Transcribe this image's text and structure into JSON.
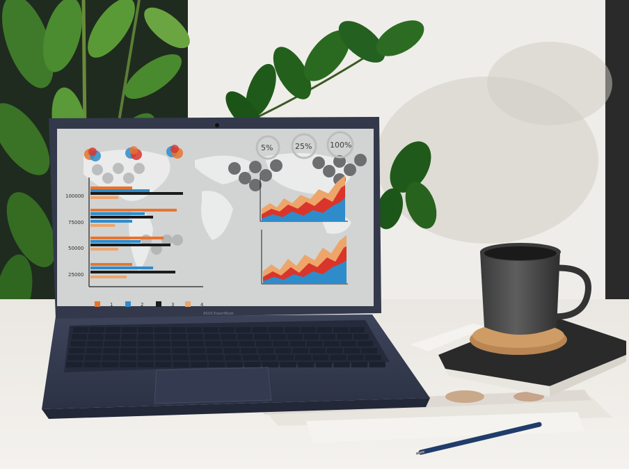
{
  "laptop": {
    "brand": "ASUS ExpertBook"
  },
  "screen": {
    "percentages": [
      "5%",
      "25%",
      "100%"
    ],
    "y_ticks": [
      "100000",
      "75000",
      "50000",
      "25000"
    ],
    "legend": [
      "1",
      "2",
      "3",
      "4"
    ]
  },
  "colors": {
    "orange": "#e8742c",
    "blue": "#2f8ccb",
    "black": "#1b1b1b",
    "peach": "#eea56a",
    "red": "#d9352b",
    "laptop_body": "#3a4156",
    "screen_bg": "#cfd0d0"
  }
}
